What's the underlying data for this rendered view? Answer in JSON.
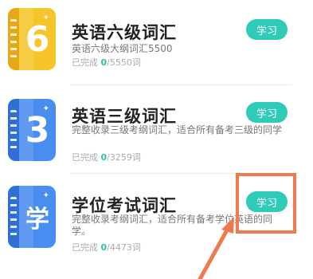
{
  "items": [
    {
      "icon_glyph": "6",
      "title": "英语六级词汇",
      "description": "英语六级大纲词汇5500",
      "progress_prefix": "已完成 ",
      "done": "0",
      "total": "/5550词",
      "button": "学习",
      "colors": {
        "cover": "#f5c52a",
        "spine": "#e8a714"
      }
    },
    {
      "icon_glyph": "3",
      "title": "英语三级词汇",
      "description": "完整收录三级考纲词汇，适合所有备考三级的同学",
      "progress_prefix": "已完成 ",
      "done": "0",
      "total": "/3259词",
      "button": "学习",
      "colors": {
        "cover": "#4a8df0",
        "spine": "#2f6fd6"
      }
    },
    {
      "icon_glyph": "学",
      "title": "学位考试词汇",
      "description": "完整收录考纲词汇，适合所有备考学位英语的同学。",
      "progress_prefix": "已完成 ",
      "done": "0",
      "total": "/4473词",
      "button": "学习",
      "colors": {
        "cover": "#4a8df0",
        "spine": "#2f6fd6"
      }
    }
  ],
  "accent": "#2fcab8",
  "highlight_color": "#ee7a4e"
}
